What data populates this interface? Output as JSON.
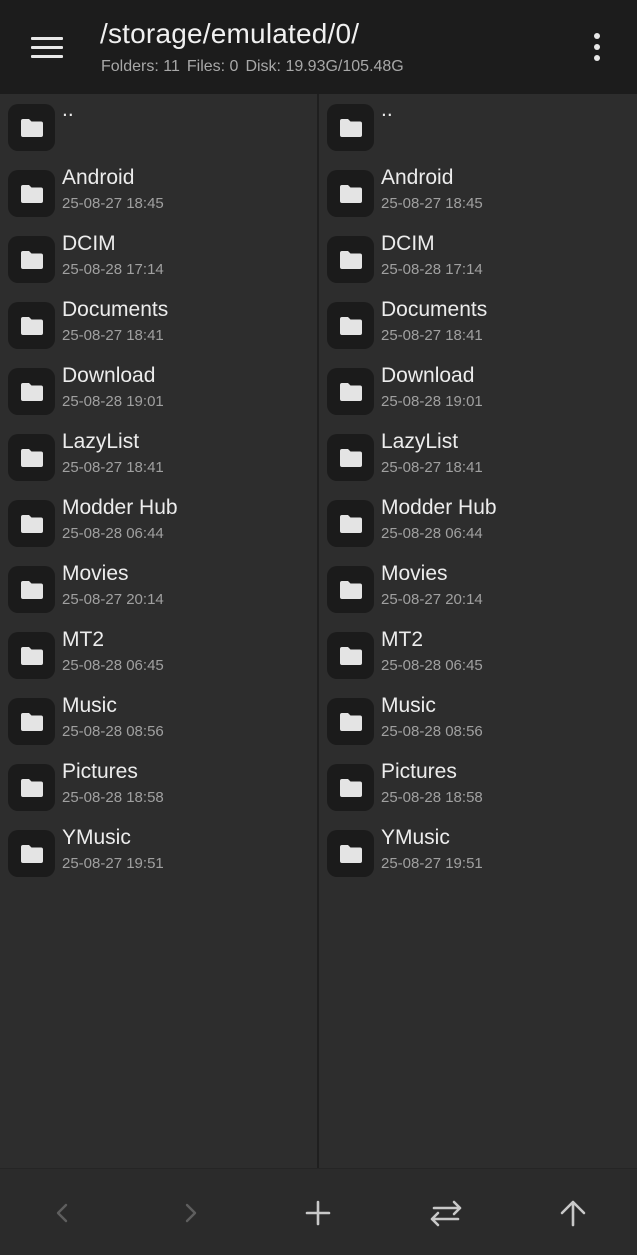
{
  "header": {
    "path": "/storage/emulated/0/",
    "folders_label": "Folders: 11",
    "files_label": "Files: 0",
    "disk_label": "Disk: 19.93G/105.48G",
    "menu_icon": "hamburger-menu-icon",
    "more_icon": "more-vertical-icon"
  },
  "left_pane": {
    "parent": "..",
    "items": [
      {
        "name": "Android",
        "date": "25-08-27 18:45"
      },
      {
        "name": "DCIM",
        "date": "25-08-28 17:14"
      },
      {
        "name": "Documents",
        "date": "25-08-27 18:41"
      },
      {
        "name": "Download",
        "date": "25-08-28 19:01"
      },
      {
        "name": "LazyList",
        "date": "25-08-27 18:41"
      },
      {
        "name": "Modder Hub",
        "date": "25-08-28 06:44"
      },
      {
        "name": "Movies",
        "date": "25-08-27 20:14"
      },
      {
        "name": "MT2",
        "date": "25-08-28 06:45"
      },
      {
        "name": "Music",
        "date": "25-08-28 08:56"
      },
      {
        "name": "Pictures",
        "date": "25-08-28 18:58"
      },
      {
        "name": "YMusic",
        "date": "25-08-27 19:51"
      }
    ]
  },
  "right_pane": {
    "parent": "..",
    "items": [
      {
        "name": "Android",
        "date": "25-08-27 18:45"
      },
      {
        "name": "DCIM",
        "date": "25-08-28 17:14"
      },
      {
        "name": "Documents",
        "date": "25-08-27 18:41"
      },
      {
        "name": "Download",
        "date": "25-08-28 19:01"
      },
      {
        "name": "LazyList",
        "date": "25-08-27 18:41"
      },
      {
        "name": "Modder Hub",
        "date": "25-08-28 06:44"
      },
      {
        "name": "Movies",
        "date": "25-08-27 20:14"
      },
      {
        "name": "MT2",
        "date": "25-08-28 06:45"
      },
      {
        "name": "Music",
        "date": "25-08-28 08:56"
      },
      {
        "name": "Pictures",
        "date": "25-08-28 18:58"
      },
      {
        "name": "YMusic",
        "date": "25-08-27 19:51"
      }
    ]
  },
  "bottom_bar": {
    "back_icon": "chevron-left-icon",
    "forward_icon": "chevron-right-icon",
    "add_icon": "plus-icon",
    "swap_icon": "swap-panes-icon",
    "up_icon": "arrow-up-icon"
  },
  "colors": {
    "toolbar_bg": "#1c1c1c",
    "pane_bg": "#2d2d2d",
    "icon_tile_bg": "#1b1b1b",
    "text_primary": "#ececec",
    "text_secondary": "#a0a0a0"
  }
}
